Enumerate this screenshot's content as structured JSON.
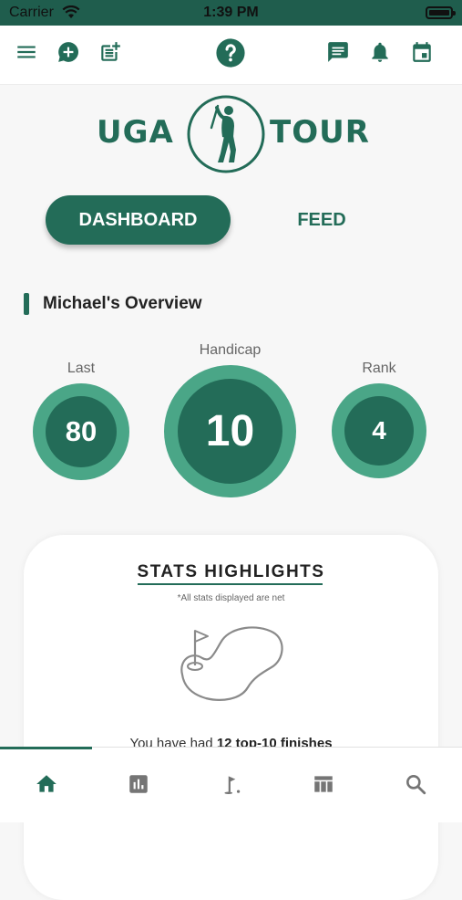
{
  "status_bar": {
    "carrier": "Carrier",
    "time": "1:39 PM"
  },
  "top_bar": {
    "left_icons": [
      "menu-icon",
      "add-comment-icon",
      "post-add-icon"
    ],
    "center_icon": "help-icon",
    "right_icons": [
      "message-icon",
      "bell-icon",
      "calendar-icon"
    ]
  },
  "logo": {
    "left_word": "UGA",
    "right_word": "TOUR"
  },
  "tabs": {
    "dashboard": "DASHBOARD",
    "feed": "FEED",
    "active": "dashboard"
  },
  "overview": {
    "title": "Michael's Overview",
    "stats": {
      "last": {
        "label": "Last",
        "value": "80"
      },
      "handicap": {
        "label": "Handicap",
        "value": "10"
      },
      "rank": {
        "label": "Rank",
        "value": "4"
      }
    }
  },
  "stats_highlights": {
    "title": "STATS HIGHLIGHTS",
    "note": "*All stats displayed are net",
    "sentence_prefix": "You have had",
    "sentence_bold": "12 top-10 finishes"
  },
  "bottom_nav": {
    "items": [
      "home-icon",
      "stats-icon",
      "golf-course-icon",
      "table-icon",
      "search-icon"
    ],
    "active": "home-icon"
  },
  "colors": {
    "primary": "#236c58",
    "accent": "#4aa687",
    "status_bar_bg": "#1f5d4d",
    "inactive_icon": "#757575"
  }
}
